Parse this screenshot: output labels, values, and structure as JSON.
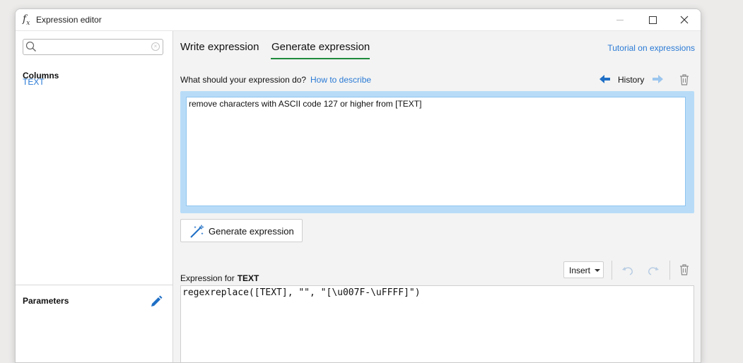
{
  "window": {
    "title": "Expression editor",
    "app_icon": "fx-icon"
  },
  "sidebar": {
    "search": {
      "placeholder": "",
      "value": ""
    },
    "columns_heading": "Columns",
    "columns": [
      "TEXT"
    ],
    "parameters_heading": "Parameters"
  },
  "tabs": [
    {
      "label": "Write expression",
      "active": false
    },
    {
      "label": "Generate expression",
      "active": true
    }
  ],
  "tutorial_link": "Tutorial on expressions",
  "generate": {
    "prompt_label": "What should your expression do?",
    "how_to_link": "How to describe",
    "history_label": "History",
    "prompt_text": "remove characters with ASCII code 127 or higher from [TEXT]",
    "button_label": "Generate expression"
  },
  "expression": {
    "label": "Expression for",
    "column": "TEXT",
    "insert_label": "Insert",
    "code": "regexreplace([TEXT], \"\", \"[\\u007F-\\uFFFF]\")"
  },
  "colors": {
    "accent_link": "#2a7ad5",
    "tab_underline": "#1f8a3c",
    "prompt_highlight": "#b8dcf8",
    "history_back_arrow": "#1f6fc5",
    "history_forward_arrow": "#9cc6ee"
  }
}
